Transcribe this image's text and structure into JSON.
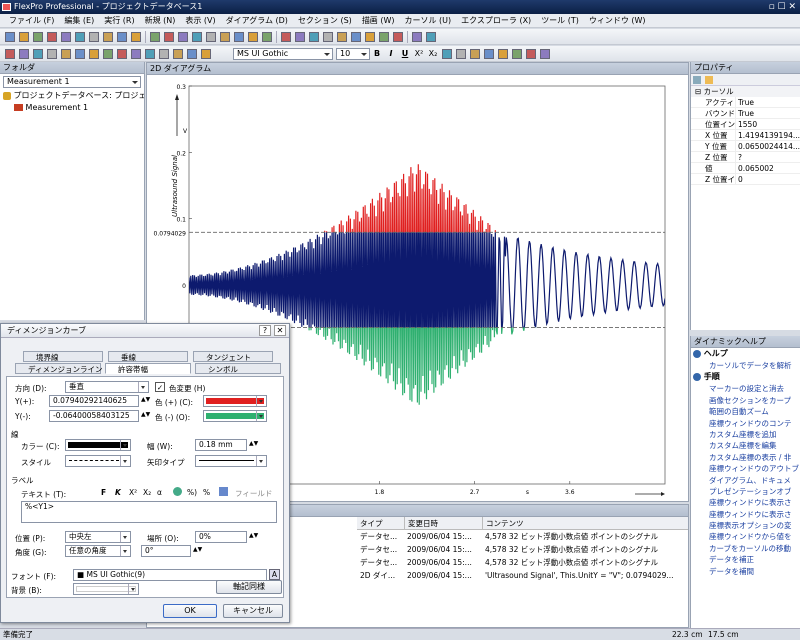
{
  "window": {
    "title": "FlexPro Professional - プロジェクトデータベース1"
  },
  "menu": [
    "ファイル (F)",
    "編集 (E)",
    "実行 (R)",
    "新規 (N)",
    "表示 (V)",
    "ダイアグラム (D)",
    "セクション (S)",
    "描画 (W)",
    "カーソル (U)",
    "エクスプローラ (X)",
    "ツール (T)",
    "ウィンドウ (W)"
  ],
  "format_toolbar": {
    "font": "MS UI Gothic",
    "size": "10",
    "bold": "B",
    "italic": "I",
    "underline": "U",
    "superscript": "X²",
    "subscript": "X₂"
  },
  "folder_pane": {
    "title": "フォルダ",
    "selector": "Measurement 1",
    "tree": [
      {
        "label": "プロジェクトデータベース: プロジェ"
      },
      {
        "label": "Measurement 1"
      }
    ]
  },
  "chart_tab": {
    "title": "2D ダイアグラム"
  },
  "chart_data": {
    "type": "line",
    "ylabel": "Ultrasound Signal",
    "yunit": "V",
    "xunit": "s",
    "yticks": [
      "0.3",
      "0.2",
      "0.1",
      "0",
      "-0.1",
      "-0.2",
      "-0.3"
    ],
    "xticks": [
      "0.9",
      "1.8",
      "2.7",
      "3.6"
    ],
    "upper_limit": "0.0794029",
    "lower_limit": "-0.0640058",
    "ylim": [
      -0.3,
      0.3
    ],
    "xlim": [
      0,
      4.5
    ],
    "series_color": "#0d1a6e",
    "upper_color": "#e02020",
    "lower_color": "#2fb070"
  },
  "properties": {
    "title": "プロパティ",
    "section": "カーソル",
    "rows": [
      {
        "k": "アクティブ",
        "v": "True"
      },
      {
        "k": "バウンド",
        "v": "True"
      },
      {
        "k": "位置インデ...",
        "v": "1550"
      },
      {
        "k": "X 位置",
        "v": "1.4194139194..."
      },
      {
        "k": "Y 位置",
        "v": "0.0650024414..."
      },
      {
        "k": "Z 位置",
        "v": "?"
      },
      {
        "k": "値",
        "v": "0.065002"
      },
      {
        "k": "Z 位置イ...",
        "v": "0"
      }
    ]
  },
  "help": {
    "title": "ダイナミックヘルプ",
    "h1": "ヘルプ",
    "h1_links": [
      "カーソルでデータを解析"
    ],
    "h2": "手順",
    "links": [
      "マーカーの設定と消去",
      "画像セクションをカープ",
      "範囲の自動ズーム",
      "座標ウィンドウのコンテ",
      "カスタム座標を追加",
      "カスタム座標を編集",
      "カスタム座標の表示 / 非",
      "座標ウィンドウのアウトブ",
      "ダイアグラム、ドキュメ",
      "プレゼンテーションオブ",
      "座標ウィンドウに表示さ",
      "座標ウィンドウに表示さ",
      "座標表示オプションの変",
      "座標ウィンドウから値を",
      "カーブをカーソルの移動",
      "データを補正",
      "データを補間"
    ]
  },
  "explorer": {
    "headers": [
      "タイプ",
      "変更日時",
      "コンテンツ"
    ],
    "rows": [
      {
        "type": "データセ...",
        "date": "2009/06/04 15:...",
        "content": "4,578 32 ビット浮動小数点値 ポイントのシグナル"
      },
      {
        "type": "データセ...",
        "date": "2009/06/04 15:...",
        "content": "4,578 32 ビット浮動小数点値 ポイントのシグナル"
      },
      {
        "type": "データセ...",
        "date": "2009/06/04 15:...",
        "content": "4,578 32 ビット浮動小数点値 ポイントのシグナル"
      },
      {
        "type": "2D ダイ...",
        "date": "2009/06/04 15:...",
        "content": "'Ultrasound Signal', This.UnitY = \"V\"; 0.0794029..."
      }
    ]
  },
  "dialog": {
    "title": "ディメンジョンカーブ",
    "help_btn": "?",
    "tabs_row1": [
      "境界線",
      "垂線",
      "タンジェント"
    ],
    "tabs_row2": [
      "ディメンジョンライン",
      "許容帯幅",
      "シンボル"
    ],
    "direction_label": "方向 (D):",
    "direction_value": "垂直",
    "color_change": "色変更 (H)",
    "yplus_label": "Y(+):",
    "yplus_value": "0.07940292140625",
    "yminus_label": "Y(-):",
    "yminus_value": "-0.06400058403125",
    "color_plus_label": "色 (+) (C):",
    "color_minus_label": "色 (-) (O):",
    "line_group": "線",
    "color_label": "カラー (C):",
    "width_label": "幅 (W):",
    "width_value": "0.18 mm",
    "style_label": "スタイル",
    "arrow_label": "矢印タイプ",
    "label_group": "ラベル",
    "text_label": "テキスト (T):",
    "field_label": "フィールド",
    "text_value": "%<Y1>",
    "position_label": "位置 (P):",
    "position_value": "中央左",
    "place_label": "場所 (O):",
    "place_value": "0%",
    "angle_label": "角度 (G):",
    "angle_value": "任意の角度",
    "angle_deg": "0°",
    "font_label": "フォント (F):",
    "font_value": "MS UI Gothic(9)",
    "bg_label": "背景 (B):",
    "axis_btn": "軸記同様",
    "ok": "OK",
    "cancel": "キャンセル"
  },
  "status": {
    "left": "準備完了",
    "pos1": "22.3 cm",
    "pos2": "17.5 cm"
  }
}
